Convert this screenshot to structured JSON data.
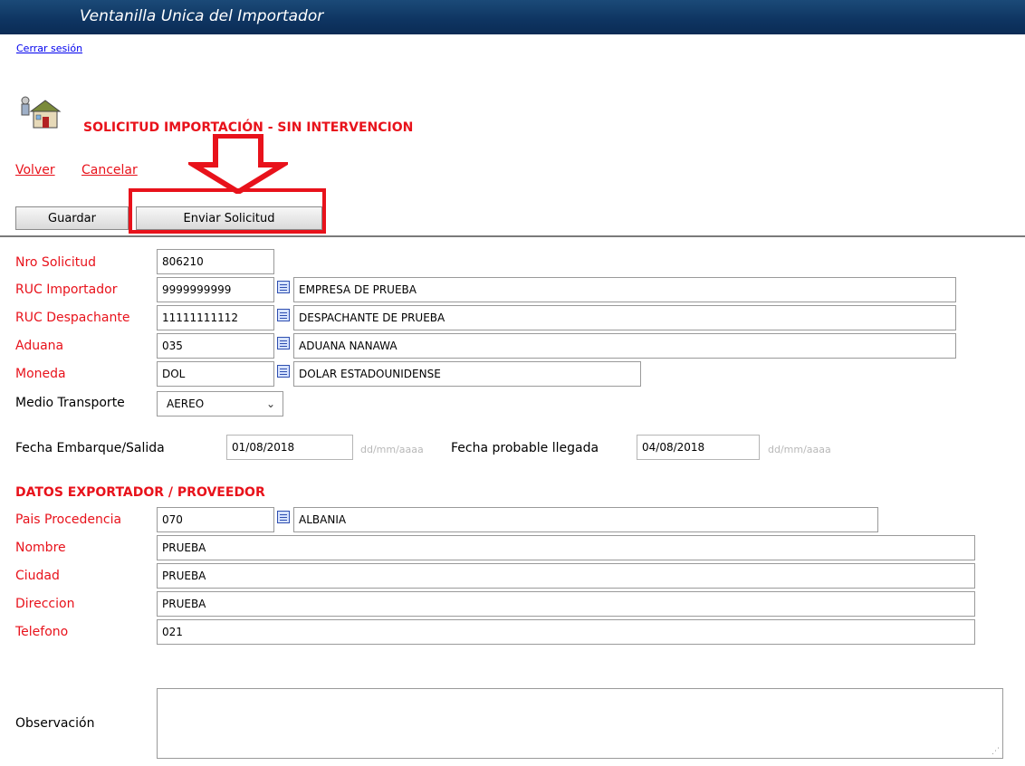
{
  "header": {
    "title": "Ventanilla Unica del Importador",
    "logout_label": "Cerrar sesión"
  },
  "page": {
    "title": "SOLICITUD IMPORTACIÓN - SIN INTERVENCION"
  },
  "nav": {
    "back_label": "Volver",
    "cancel_label": "Cancelar"
  },
  "toolbar": {
    "save_label": "Guardar",
    "send_label": "Enviar Solicitud"
  },
  "form": {
    "nro_solicitud": {
      "label": "Nro Solicitud",
      "value": "806210"
    },
    "ruc_importador": {
      "label": "RUC Importador",
      "code": "9999999999",
      "name": "EMPRESA DE PRUEBA"
    },
    "ruc_despachante": {
      "label": "RUC Despachante",
      "code": "11111111112",
      "name": "DESPACHANTE DE PRUEBA"
    },
    "aduana": {
      "label": "Aduana",
      "code": "035",
      "name": "ADUANA NANAWA"
    },
    "moneda": {
      "label": "Moneda",
      "code": "DOL",
      "name": "DOLAR ESTADOUNIDENSE"
    },
    "medio_transporte": {
      "label": "Medio Transporte",
      "selected": "AEREO"
    },
    "fecha_embarque": {
      "label": "Fecha Embarque/Salida",
      "value": "01/08/2018",
      "hint": "dd/mm/aaaa"
    },
    "fecha_llegada": {
      "label": "Fecha probable llegada",
      "value": "04/08/2018",
      "hint": "dd/mm/aaaa"
    }
  },
  "exportador": {
    "section_title": "DATOS EXPORTADOR / PROVEEDOR",
    "pais": {
      "label": "Pais Procedencia",
      "code": "070",
      "name": "ALBANIA"
    },
    "nombre": {
      "label": "Nombre",
      "value": "PRUEBA"
    },
    "ciudad": {
      "label": "Ciudad",
      "value": "PRUEBA"
    },
    "direccion": {
      "label": "Direccion",
      "value": "PRUEBA"
    },
    "telefono": {
      "label": "Telefono",
      "value": "021"
    }
  },
  "observacion": {
    "label": "Observación",
    "value": ""
  },
  "colors": {
    "header_bg": "#0e3461",
    "required_red": "#e8121b",
    "annotation_red": "#e8121b",
    "link_blue": "#0000ee"
  },
  "icons": [
    "house-user-icon",
    "lookup-list-icon",
    "chevron-down-icon",
    "annotation-arrow-icon"
  ]
}
